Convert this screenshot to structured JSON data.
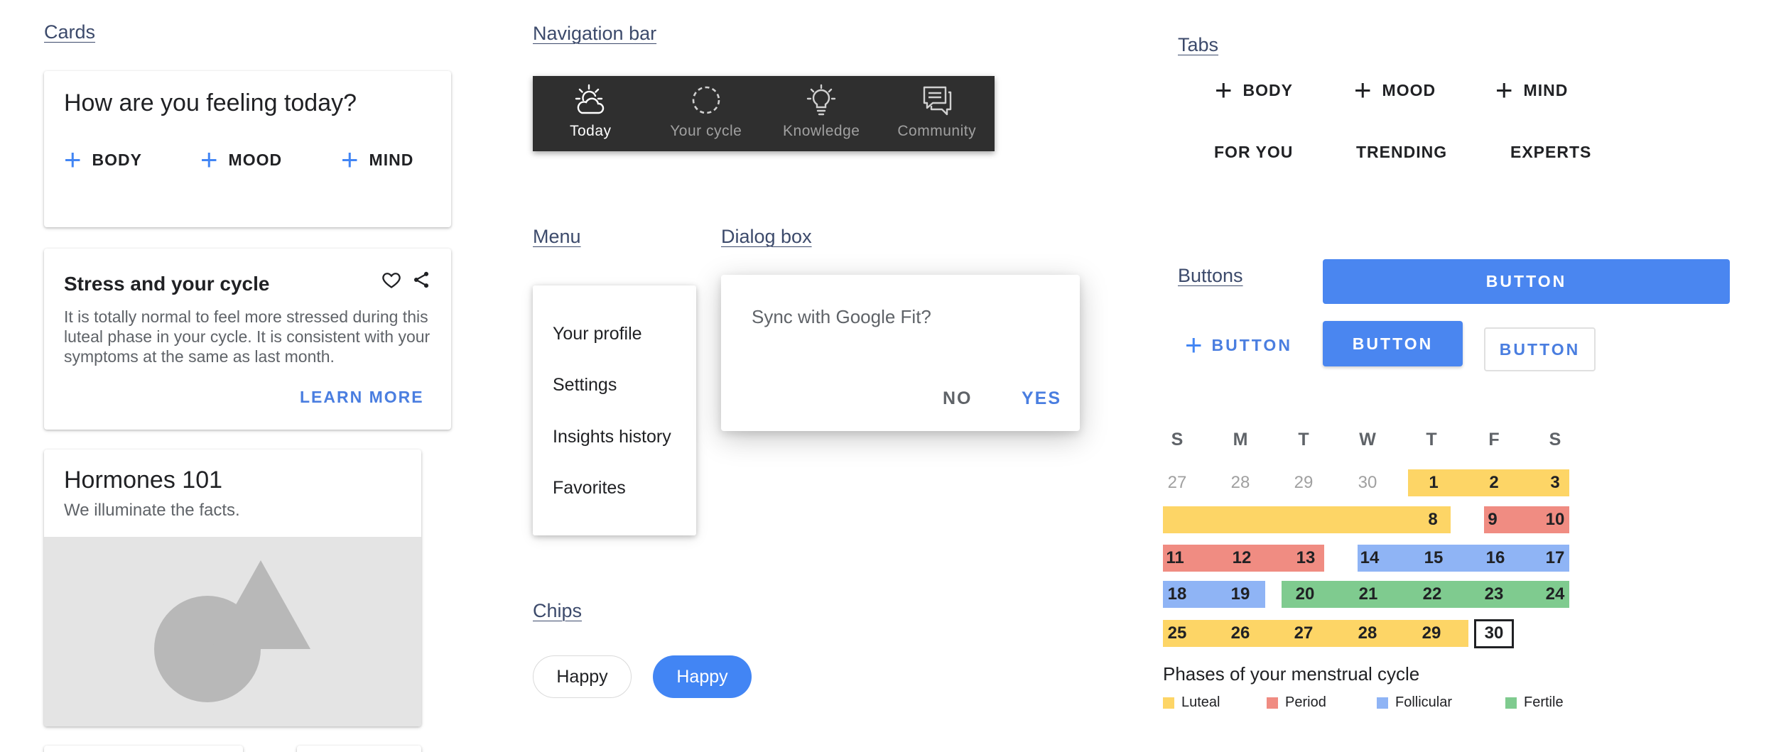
{
  "colors": {
    "luteal": "#fdd566",
    "period": "#f08c82",
    "follicular": "#8fb4f5",
    "fertile": "#7fcb8f",
    "accent": "#4285f4"
  },
  "sections": {
    "cards": "Cards",
    "navbar": "Navigation bar",
    "tabs": "Tabs",
    "menu": "Menu",
    "dialog": "Dialog box",
    "buttons": "Buttons",
    "chips": "Chips"
  },
  "feeling_card": {
    "title": "How are you feeling today?",
    "buttons": [
      "BODY",
      "MOOD",
      "MIND"
    ]
  },
  "stress_card": {
    "title": "Stress and your cycle",
    "body": "It is totally normal to feel more stressed during this luteal phase in your cycle. It is consistent with your symptoms at the same as last month.",
    "action": "LEARN MORE",
    "icons": [
      "heart-outline-icon",
      "share-icon"
    ]
  },
  "hormones_card": {
    "title": "Hormones 101",
    "subtitle": "We illuminate the facts."
  },
  "navbar": {
    "items": [
      {
        "label": "Today",
        "icon": "sun-cloud-icon",
        "active": true
      },
      {
        "label": "Your cycle",
        "icon": "dashed-circle-icon",
        "active": false
      },
      {
        "label": "Knowledge",
        "icon": "lightbulb-icon",
        "active": false
      },
      {
        "label": "Community",
        "icon": "chat-bubbles-icon",
        "active": false
      }
    ]
  },
  "menu": {
    "items": [
      "Your profile",
      "Settings",
      "Insights history",
      "Favorites"
    ]
  },
  "dialog": {
    "text": "Sync with Google Fit?",
    "no": "NO",
    "yes": "YES"
  },
  "chips": {
    "outlined": "Happy",
    "selected": "Happy"
  },
  "tabs": {
    "row1": [
      "BODY",
      "MOOD",
      "MIND"
    ],
    "row2": [
      "FOR YOU",
      "TRENDING",
      "EXPERTS"
    ]
  },
  "buttons": {
    "filled_wide": "BUTTON",
    "text_with_icon": "BUTTON",
    "filled": "BUTTON",
    "outlined": "BUTTON"
  },
  "calendar": {
    "weekdays": [
      "S",
      "M",
      "T",
      "W",
      "T",
      "F",
      "S"
    ],
    "rows": [
      [
        "27",
        "28",
        "29",
        "30",
        "1",
        "2",
        "3"
      ],
      [
        "",
        "",
        "",
        "",
        "8",
        "",
        "9",
        "10"
      ],
      [
        "11",
        "12",
        "13",
        "14",
        "15",
        "16",
        "17"
      ],
      [
        "18",
        "19",
        "20",
        "21",
        "22",
        "23",
        "24"
      ],
      [
        "25",
        "26",
        "27",
        "28",
        "29",
        "30"
      ]
    ],
    "today": "30",
    "legend_title": "Phases of your menstrual cycle",
    "legend": [
      {
        "label": "Luteal",
        "phase": "luteal"
      },
      {
        "label": "Period",
        "phase": "period"
      },
      {
        "label": "Follicular",
        "phase": "follicular"
      },
      {
        "label": "Fertile",
        "phase": "fertile"
      }
    ]
  }
}
